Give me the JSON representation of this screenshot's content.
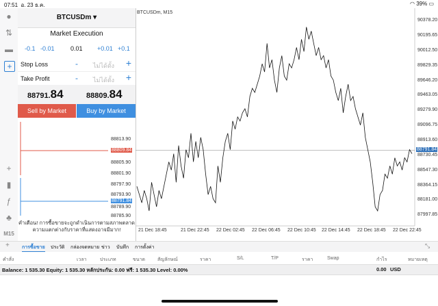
{
  "status": {
    "time": "07:51",
    "date": "อ. 23 ธ.ค.",
    "battery": "39%"
  },
  "panel": {
    "symbol": "BTCUSDm ▾",
    "execution": "Market Execution",
    "lot": {
      "m1": "-0.1",
      "m2": "-0.01",
      "value": "0.01",
      "p1": "+0.01",
      "p2": "+0.1"
    },
    "stop_loss": {
      "label": "Stop Loss",
      "minus": "-",
      "placeholder": "ไม่ได้ตั้ง",
      "plus": "+"
    },
    "take_profit": {
      "label": "Take Profit",
      "minus": "-",
      "placeholder": "ไม่ได้ตั้ง",
      "plus": "+"
    },
    "bid": {
      "main": "88791.",
      "big": "84"
    },
    "ask": {
      "main": "88809.",
      "big": "84"
    },
    "sell_label": "Sell by Market",
    "buy_label": "Buy by Market",
    "tick_labels": [
      "88813.90",
      "88809.84",
      "88805.90",
      "88801.90",
      "88797.90",
      "88793.90",
      "88791.84",
      "88789.90",
      "88785.90"
    ],
    "warning": "คำเตือน! การซื้อขายจะถูกดำเนินการตามสภาพตลาด ความแตกต่างกับราคาที่แสดงอาจมีมาก!"
  },
  "chart": {
    "title": "BTCUSDm, M15",
    "y_labels": [
      "90378.20",
      "90195.65",
      "90012.50",
      "89829.35",
      "89646.20",
      "89463.05",
      "89279.90",
      "89096.75",
      "88913.60",
      "88730.45",
      "88547.30",
      "88364.15",
      "88181.00",
      "87997.85"
    ],
    "current_price": "88791.84",
    "x_labels": [
      "21 Dec 18:45",
      "21 Dec 22:45",
      "22 Dec 02:45",
      "22 Dec 06:45",
      "22 Dec 10:45",
      "22 Dec 14:45",
      "22 Dec 18:45",
      "22 Dec 22:45"
    ]
  },
  "chart_data": {
    "type": "line",
    "title": "BTCUSDm, M15",
    "ylim": [
      87900,
      90480
    ],
    "current_price": 88791.84,
    "values": [
      88350,
      88250,
      88150,
      88300,
      88200,
      88050,
      88400,
      88250,
      88100,
      88300,
      88200,
      88350,
      88500,
      88650,
      88550,
      88750,
      88400,
      88850,
      88600,
      88450,
      88800,
      88700,
      89000,
      88650,
      88900,
      88700,
      88950,
      88800,
      88500,
      88250,
      88350,
      88200,
      88150,
      88600,
      88400,
      88700,
      88900,
      89000,
      88800,
      89150,
      89050,
      89200,
      89150,
      89250,
      89300,
      89200,
      89450,
      89550,
      89500,
      89600,
      89700,
      89850,
      89750,
      90100,
      89800,
      89900,
      89650,
      89500,
      89800,
      89950,
      89700,
      89650,
      89850,
      89800,
      89900,
      90050,
      89900,
      90150,
      90000,
      90300,
      90150,
      90250,
      90100,
      89950,
      90050,
      89900,
      89950,
      89800,
      89900,
      89700,
      89650,
      89500,
      89400,
      89550,
      89250,
      89450,
      89600,
      89400,
      89450,
      89300,
      89200,
      89100,
      89250,
      88950,
      88800,
      88650,
      88400,
      88100,
      88050,
      88250,
      88300,
      88500,
      88450,
      88600,
      88500,
      88700,
      88600,
      88650,
      88550,
      88700,
      88650,
      88800,
      88750
    ]
  },
  "tabs": [
    "การซื้อขาย",
    "ประวัติ",
    "กล่องจดหมาย",
    "ข่าว",
    "บันทึก",
    "การตั้งค่า"
  ],
  "columns": [
    "คำสั่ง",
    "เวลา",
    "ประเภท",
    "ขนาด",
    "สัญลักษณ์",
    "ราคา",
    "S/L",
    "T/P",
    "ราคา",
    "Swap",
    "กำไร",
    "หมายเหตุ"
  ],
  "balance": {
    "text": "Balance: 1 535.30 Equity: 1 535.30 หลักประกัน: 0.00 ฟรี: 1 535.30 Level: 0.00%",
    "profit": "0.00",
    "currency": "USD"
  },
  "accent": "#2d7fd3",
  "sell_color": "#e05a4a",
  "buy_color": "#3f8fe0"
}
